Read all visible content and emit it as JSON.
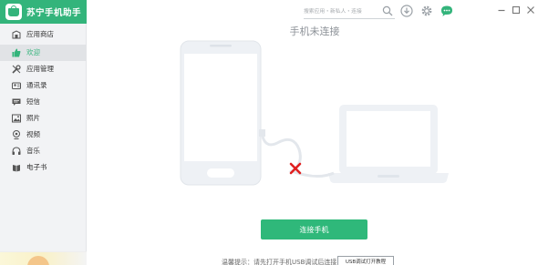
{
  "app": {
    "title": "苏宁手机助手"
  },
  "sidebar": {
    "items": [
      {
        "label": "应用商店",
        "icon": "store-icon"
      },
      {
        "label": "欢迎",
        "icon": "thumbs-up-icon",
        "active": true
      },
      {
        "label": "应用管理",
        "icon": "tools-icon"
      },
      {
        "label": "通讯录",
        "icon": "contacts-icon"
      },
      {
        "label": "短信",
        "icon": "message-icon"
      },
      {
        "label": "照片",
        "icon": "photo-icon"
      },
      {
        "label": "视频",
        "icon": "video-icon"
      },
      {
        "label": "音乐",
        "icon": "music-icon"
      },
      {
        "label": "电子书",
        "icon": "ebook-icon"
      }
    ]
  },
  "topbar": {
    "search_placeholder": "搜索应用・新私人・连接",
    "icons": [
      "search-icon",
      "download-icon",
      "settings-icon",
      "chat-icon"
    ],
    "window_controls": [
      "minimize-icon",
      "maximize-icon",
      "close-icon"
    ]
  },
  "main": {
    "status_title": "手机未连接",
    "connect_button": "连接手机",
    "tip_text": "温馨提示：请先打开手机USB调试后连接",
    "tip_button": "USB调试打开教程"
  },
  "colors": {
    "brand": "#33b47b",
    "button": "#2fb87a",
    "error": "#e02020",
    "device": "#eef1f5"
  }
}
